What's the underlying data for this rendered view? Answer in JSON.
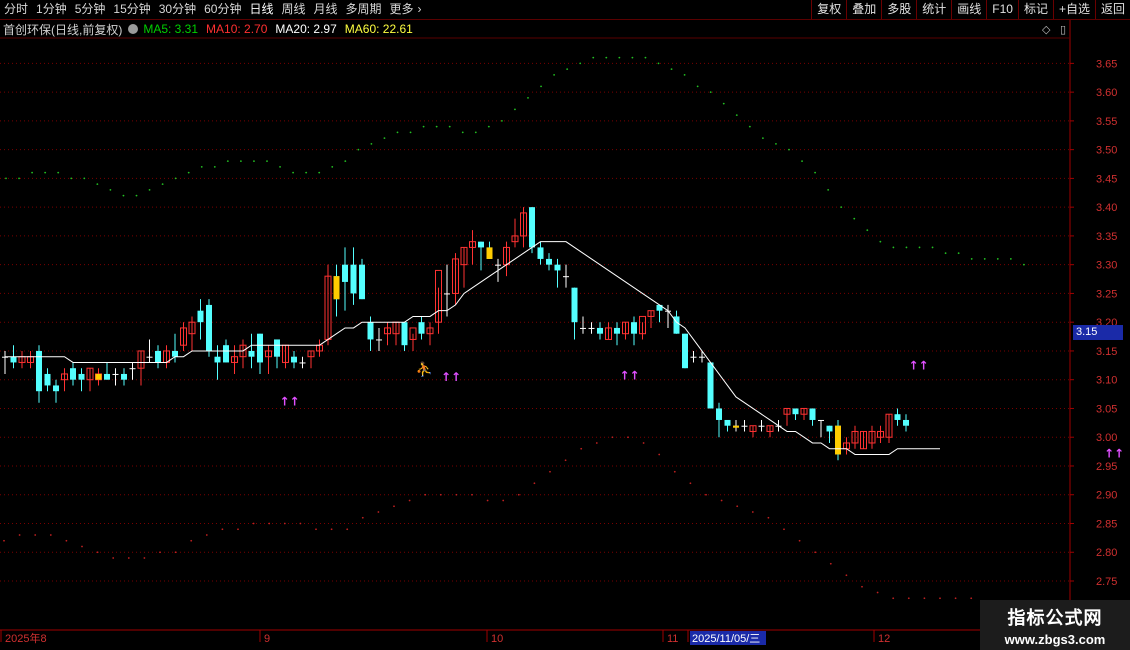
{
  "toolbar": {
    "tabs": [
      "分时",
      "1分钟",
      "5分钟",
      "15分钟",
      "30分钟",
      "60分钟",
      "日线",
      "周线",
      "月线",
      "多周期",
      "更多"
    ],
    "active_tab": "日线",
    "more_arrow": "›",
    "right_buttons": [
      "复权",
      "叠加",
      "多股",
      "统计",
      "画线",
      "F10",
      "标记",
      "+自选",
      "返回"
    ]
  },
  "legend": {
    "stock": "首创环保(日线,前复权)",
    "ma5": "MA5: 3.31",
    "ma10": "MA10: 2.70",
    "ma20": "MA20: 2.97",
    "ma60": "MA60: 22.61",
    "colors": {
      "ma5": "#00d000",
      "ma10": "#ff3030",
      "ma20": "#ffffff",
      "ma60": "#ffff40"
    }
  },
  "controls": {
    "diamond_icon": "◇",
    "panel_icon": "▯"
  },
  "current_price_tag": "3.15",
  "watermark": {
    "title": "指标公式网",
    "url": "www.zbgs3.com"
  },
  "date_axis": {
    "labels": [
      "2025年8",
      "9",
      "10",
      "11",
      "2025/11/05/三",
      "12"
    ]
  },
  "chart_data": {
    "type": "candlestick",
    "y_axis": {
      "ticks": [
        "3.65",
        "3.60",
        "3.55",
        "3.50",
        "3.45",
        "3.40",
        "3.35",
        "3.30",
        "3.25",
        "3.20",
        "3.15",
        "3.10",
        "3.05",
        "3.00",
        "2.95",
        "2.90",
        "2.85",
        "2.80",
        "2.75"
      ],
      "range": [
        2.72,
        3.7
      ],
      "grid": true
    },
    "candles": [
      [
        3.14,
        3.15,
        3.11,
        3.14
      ],
      [
        3.14,
        3.16,
        3.12,
        3.13
      ],
      [
        3.13,
        3.15,
        3.12,
        3.14
      ],
      [
        3.13,
        3.15,
        3.12,
        3.14
      ],
      [
        3.15,
        3.16,
        3.06,
        3.08
      ],
      [
        3.11,
        3.12,
        3.08,
        3.09
      ],
      [
        3.09,
        3.1,
        3.06,
        3.08
      ],
      [
        3.1,
        3.12,
        3.08,
        3.11
      ],
      [
        3.12,
        3.13,
        3.09,
        3.1
      ],
      [
        3.11,
        3.12,
        3.08,
        3.1
      ],
      [
        3.1,
        3.12,
        3.08,
        3.12
      ],
      [
        3.1,
        3.12,
        3.09,
        3.11
      ],
      [
        3.11,
        3.13,
        3.1,
        3.1
      ],
      [
        3.11,
        3.12,
        3.09,
        3.11
      ],
      [
        3.11,
        3.12,
        3.09,
        3.1
      ],
      [
        3.12,
        3.13,
        3.1,
        3.12
      ],
      [
        3.12,
        3.15,
        3.09,
        3.15
      ],
      [
        3.14,
        3.17,
        3.13,
        3.14
      ],
      [
        3.15,
        3.16,
        3.12,
        3.13
      ],
      [
        3.13,
        3.16,
        3.12,
        3.15
      ],
      [
        3.15,
        3.18,
        3.13,
        3.14
      ],
      [
        3.16,
        3.2,
        3.15,
        3.19
      ],
      [
        3.18,
        3.21,
        3.15,
        3.2
      ],
      [
        3.22,
        3.24,
        3.17,
        3.2
      ],
      [
        3.23,
        3.24,
        3.14,
        3.15
      ],
      [
        3.14,
        3.16,
        3.1,
        3.13
      ],
      [
        3.16,
        3.17,
        3.13,
        3.13
      ],
      [
        3.13,
        3.16,
        3.11,
        3.14
      ],
      [
        3.14,
        3.17,
        3.12,
        3.16
      ],
      [
        3.15,
        3.18,
        3.12,
        3.14
      ],
      [
        3.18,
        3.18,
        3.11,
        3.13
      ],
      [
        3.14,
        3.16,
        3.11,
        3.15
      ],
      [
        3.17,
        3.17,
        3.12,
        3.14
      ],
      [
        3.13,
        3.16,
        3.12,
        3.16
      ],
      [
        3.14,
        3.15,
        3.12,
        3.13
      ],
      [
        3.13,
        3.14,
        3.12,
        3.13
      ],
      [
        3.14,
        3.15,
        3.12,
        3.15
      ],
      [
        3.15,
        3.17,
        3.14,
        3.16
      ],
      [
        3.17,
        3.3,
        3.16,
        3.28
      ],
      [
        3.28,
        3.3,
        3.21,
        3.24
      ],
      [
        3.3,
        3.33,
        3.22,
        3.27
      ],
      [
        3.3,
        3.33,
        3.23,
        3.25
      ],
      [
        3.3,
        3.31,
        3.24,
        3.24
      ],
      [
        3.2,
        3.21,
        3.15,
        3.17
      ],
      [
        3.17,
        3.19,
        3.15,
        3.17
      ],
      [
        3.18,
        3.2,
        3.16,
        3.19
      ],
      [
        3.18,
        3.2,
        3.16,
        3.2
      ],
      [
        3.2,
        3.2,
        3.15,
        3.16
      ],
      [
        3.17,
        3.18,
        3.15,
        3.19
      ],
      [
        3.2,
        3.21,
        3.17,
        3.18
      ],
      [
        3.18,
        3.2,
        3.16,
        3.19
      ],
      [
        3.2,
        3.26,
        3.18,
        3.29
      ],
      [
        3.25,
        3.3,
        3.21,
        3.25
      ],
      [
        3.25,
        3.32,
        3.23,
        3.31
      ],
      [
        3.3,
        3.33,
        3.26,
        3.33
      ],
      [
        3.33,
        3.36,
        3.3,
        3.34
      ],
      [
        3.34,
        3.34,
        3.29,
        3.33
      ],
      [
        3.33,
        3.34,
        3.31,
        3.31
      ],
      [
        3.3,
        3.31,
        3.27,
        3.3
      ],
      [
        3.3,
        3.34,
        3.28,
        3.33
      ],
      [
        3.34,
        3.38,
        3.33,
        3.35
      ],
      [
        3.35,
        3.4,
        3.33,
        3.39
      ],
      [
        3.4,
        3.4,
        3.32,
        3.33
      ],
      [
        3.33,
        3.34,
        3.3,
        3.31
      ],
      [
        3.31,
        3.32,
        3.29,
        3.3
      ],
      [
        3.3,
        3.31,
        3.26,
        3.29
      ],
      [
        3.28,
        3.3,
        3.26,
        3.28
      ],
      [
        3.26,
        3.26,
        3.17,
        3.2
      ],
      [
        3.19,
        3.21,
        3.18,
        3.19
      ],
      [
        3.19,
        3.2,
        3.18,
        3.19
      ],
      [
        3.19,
        3.2,
        3.17,
        3.18
      ],
      [
        3.17,
        3.2,
        3.17,
        3.19
      ],
      [
        3.19,
        3.2,
        3.16,
        3.18
      ],
      [
        3.18,
        3.2,
        3.17,
        3.2
      ],
      [
        3.2,
        3.21,
        3.16,
        3.18
      ],
      [
        3.18,
        3.2,
        3.17,
        3.21
      ],
      [
        3.21,
        3.22,
        3.19,
        3.22
      ],
      [
        3.23,
        3.23,
        3.2,
        3.22
      ],
      [
        3.22,
        3.23,
        3.19,
        3.22
      ],
      [
        3.21,
        3.22,
        3.18,
        3.18
      ],
      [
        3.18,
        3.18,
        3.12,
        3.12
      ],
      [
        3.14,
        3.15,
        3.13,
        3.14
      ],
      [
        3.14,
        3.15,
        3.13,
        3.14
      ],
      [
        3.13,
        3.13,
        3.05,
        3.05
      ],
      [
        3.05,
        3.06,
        3.0,
        3.03
      ],
      [
        3.03,
        3.03,
        3.01,
        3.02
      ],
      [
        3.02,
        3.03,
        3.01,
        3.02
      ],
      [
        3.02,
        3.03,
        3.01,
        3.02
      ],
      [
        3.01,
        3.02,
        3.0,
        3.02
      ],
      [
        3.02,
        3.03,
        3.01,
        3.02
      ],
      [
        3.01,
        3.02,
        3.0,
        3.02
      ],
      [
        3.02,
        3.03,
        3.01,
        3.02
      ],
      [
        3.04,
        3.05,
        3.02,
        3.05
      ],
      [
        3.05,
        3.05,
        3.03,
        3.04
      ],
      [
        3.04,
        3.05,
        3.03,
        3.05
      ],
      [
        3.05,
        3.05,
        3.02,
        3.03
      ],
      [
        3.03,
        3.03,
        3.0,
        3.03
      ],
      [
        3.02,
        3.02,
        2.99,
        3.01
      ],
      [
        3.02,
        3.03,
        2.96,
        2.97
      ],
      [
        2.98,
        3.0,
        2.97,
        2.99
      ],
      [
        2.99,
        3.02,
        2.98,
        3.01
      ],
      [
        2.98,
        3.01,
        2.98,
        3.01
      ],
      [
        2.99,
        3.02,
        2.98,
        3.01
      ],
      [
        3.0,
        3.02,
        2.99,
        3.01
      ],
      [
        3.0,
        3.04,
        2.99,
        3.04
      ],
      [
        3.04,
        3.05,
        3.02,
        3.03
      ],
      [
        3.03,
        3.04,
        3.01,
        3.02
      ]
    ],
    "ma_white": [
      3.14,
      3.14,
      3.14,
      3.14,
      3.14,
      3.14,
      3.14,
      3.14,
      3.13,
      3.13,
      3.13,
      3.13,
      3.13,
      3.13,
      3.13,
      3.13,
      3.13,
      3.13,
      3.13,
      3.13,
      3.14,
      3.14,
      3.15,
      3.15,
      3.15,
      3.15,
      3.15,
      3.15,
      3.15,
      3.16,
      3.16,
      3.16,
      3.16,
      3.16,
      3.16,
      3.16,
      3.16,
      3.16,
      3.17,
      3.18,
      3.19,
      3.19,
      3.2,
      3.2,
      3.2,
      3.2,
      3.2,
      3.2,
      3.21,
      3.21,
      3.21,
      3.22,
      3.22,
      3.23,
      3.25,
      3.26,
      3.27,
      3.28,
      3.29,
      3.3,
      3.31,
      3.32,
      3.33,
      3.34,
      3.34,
      3.34,
      3.34,
      3.33,
      3.32,
      3.31,
      3.3,
      3.29,
      3.28,
      3.27,
      3.26,
      3.25,
      3.24,
      3.23,
      3.22,
      3.2,
      3.19,
      3.17,
      3.15,
      3.13,
      3.11,
      3.09,
      3.07,
      3.06,
      3.05,
      3.04,
      3.03,
      3.02,
      3.01,
      3.01,
      3.0,
      2.99,
      2.99,
      2.98,
      2.98,
      2.98,
      2.97,
      2.97,
      2.97,
      2.97,
      2.97,
      2.98,
      2.98,
      2.98,
      2.98,
      2.98,
      2.98
    ],
    "upper_band": [
      3.45,
      3.45,
      3.46,
      3.46,
      3.46,
      3.45,
      3.45,
      3.44,
      3.43,
      3.42,
      3.42,
      3.43,
      3.44,
      3.45,
      3.46,
      3.47,
      3.47,
      3.48,
      3.48,
      3.48,
      3.48,
      3.47,
      3.46,
      3.46,
      3.46,
      3.47,
      3.48,
      3.5,
      3.51,
      3.52,
      3.53,
      3.53,
      3.54,
      3.54,
      3.54,
      3.53,
      3.53,
      3.54,
      3.55,
      3.57,
      3.59,
      3.61,
      3.63,
      3.64,
      3.65,
      3.66,
      3.66,
      3.66,
      3.66,
      3.66,
      3.65,
      3.64,
      3.63,
      3.61,
      3.6,
      3.58,
      3.56,
      3.54,
      3.52,
      3.51,
      3.5,
      3.48,
      3.46,
      3.43,
      3.4,
      3.38,
      3.36,
      3.34,
      3.33,
      3.33,
      3.33,
      3.33,
      3.32,
      3.32,
      3.31,
      3.31,
      3.31,
      3.31,
      3.3
    ],
    "lower_band": [
      2.82,
      2.83,
      2.83,
      2.83,
      2.82,
      2.81,
      2.8,
      2.79,
      2.79,
      2.79,
      2.8,
      2.8,
      2.82,
      2.83,
      2.84,
      2.84,
      2.85,
      2.85,
      2.85,
      2.85,
      2.84,
      2.84,
      2.84,
      2.86,
      2.87,
      2.88,
      2.89,
      2.9,
      2.9,
      2.9,
      2.9,
      2.89,
      2.89,
      2.9,
      2.92,
      2.94,
      2.96,
      2.98,
      2.99,
      3.0,
      3.0,
      2.99,
      2.97,
      2.94,
      2.92,
      2.9,
      2.89,
      2.88,
      2.87,
      2.86,
      2.84,
      2.82,
      2.8,
      2.78,
      2.76,
      2.74,
      2.73,
      2.72,
      2.72,
      2.72,
      2.72,
      2.72,
      2.72
    ],
    "up_arrows": [
      [
        33,
        3.055
      ],
      [
        52,
        3.098
      ],
      [
        73,
        3.1
      ],
      [
        107,
        3.118
      ],
      [
        130,
        2.965
      ],
      [
        147,
        2.948
      ]
    ],
    "person_markers": [
      [
        49,
        3.11
      ],
      [
        143,
        2.97
      ]
    ]
  }
}
